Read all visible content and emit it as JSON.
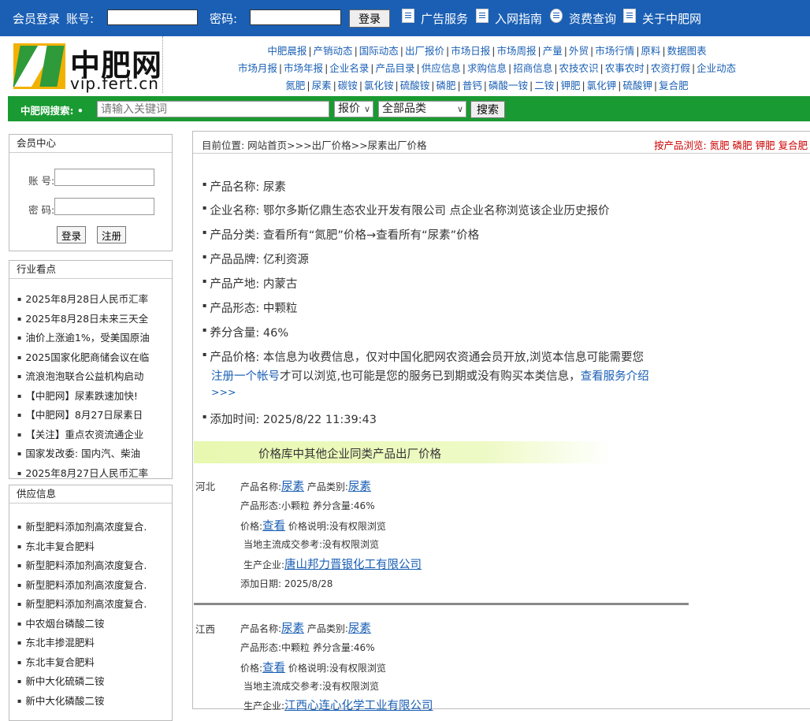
{
  "topbar": {
    "member_login": "会员登录",
    "account_label": "账号:",
    "password_label": "密码:",
    "login_button": "登录",
    "links": [
      "广告服务",
      "入网指南",
      "资费查询",
      "关于中肥网"
    ]
  },
  "logo": {
    "name": "中肥网",
    "url": "vip.fert.cn"
  },
  "nav": {
    "row1": [
      "中肥晨报",
      "产销动态",
      "国际动态",
      "出厂报价",
      "市场日报",
      "市场周报",
      "产量",
      "外贸",
      "市场行情",
      "原料",
      "数据图表"
    ],
    "row2": [
      "市场月报",
      "市场年报",
      "企业名录",
      "产品目录",
      "供应信息",
      "求购信息",
      "招商信息",
      "农技农识",
      "农事农时",
      "农资打假",
      "企业动态"
    ],
    "row3": [
      "氮肥",
      "尿素",
      "碳铵",
      "氯化铵",
      "硫酸铵",
      "磷肥",
      "普钙",
      "磷酸一铵",
      "二铵",
      "钾肥",
      "氯化钾",
      "硫酸钾",
      "复合肥"
    ]
  },
  "search": {
    "label": "中肥网搜索:",
    "placeholder": "请输入关键词",
    "type_select": "报价",
    "category_select": "全部品类",
    "button": "搜索"
  },
  "sidebar": {
    "member": {
      "title": "会员中心",
      "account_label": "账 号:",
      "password_label": "密 码:",
      "login": "登录",
      "register": "注册"
    },
    "industry": {
      "title": "行业看点",
      "items": [
        "2025年8月28日人民币汇率",
        "2025年8月28日未来三天全",
        "油价上涨逾1%，受美国原油",
        "2025国家化肥商储会议在临",
        "流浪泡泡联合公益机构启动",
        "【中肥网】尿素跌速加快!",
        "【中肥网】8月27日尿素日",
        "【关注】重点农资流通企业",
        "国家发改委: 国内汽、柴油",
        "2025年8月27日人民币汇率"
      ]
    },
    "supply": {
      "title": "供应信息",
      "items": [
        "新型肥料添加剂高浓度复合.",
        "东北丰复合肥料",
        "新型肥料添加剂高浓度复合.",
        "新型肥料添加剂高浓度复合.",
        "新型肥料添加剂高浓度复合.",
        "中农烟台磷酸二铵",
        "东北丰掺混肥料",
        "东北丰复合肥料",
        "新中大化硫磷二铵",
        "新中大化磷酸二铵"
      ]
    }
  },
  "breadcrumb": "目前位置: 网站首页>>>出厂价格>>尿素出厂价格",
  "browse": "按产品浏览: 氮肥 磷肥 钾肥 复合肥",
  "detail": {
    "name_label": "产品名称: ",
    "name": "尿素",
    "company_label": "企业名称: ",
    "company": "鄂尔多斯亿鼎生态农业开发有限公司",
    "company_hint": "点企业名称浏览该企业历史报价",
    "category_label": "产品分类: ",
    "category_text": "查看所有“氮肥”价格→查看所有“尿素”价格",
    "brand_label": "产品品牌: ",
    "brand": "亿利资源",
    "origin_label": "产品产地: ",
    "origin": "内蒙古",
    "form_label": "产品形态: ",
    "form": "中颗粒",
    "nutrient_label": "养分含量: ",
    "nutrient": "46%",
    "price_label": "产品价格: ",
    "price_line1": "本信息为收费信息，仅对中国化肥网农资通会员开放,浏览本信息可能需要您",
    "price_register": "注册一个帐号",
    "price_line2": "才可以浏览,也可能是您的服务已到期或没有购买本类信息，",
    "price_service": "查看服务介绍",
    "price_more": ">>>",
    "added_label": "添加时间: ",
    "added": "2025/8/22 11:39:43"
  },
  "others_title": "价格库中其他企业同类产品出厂价格",
  "listings": [
    {
      "province": "河北",
      "name_label": "产品名称:",
      "name": "尿素",
      "cat_label": "产品类别:",
      "cat": "尿素",
      "form": "产品形态:小颗粒",
      "nutrient": "养分含量:46%",
      "price_label": "价格:",
      "price_link": "查看",
      "price_note": "价格说明:没有权限浏览",
      "ref": "当地主流成交参考:没有权限浏览",
      "company_label": "生产企业:",
      "company": "唐山邦力晋银化工有限公司",
      "date": "添加日期: 2025/8/28"
    },
    {
      "province": "江西",
      "name_label": "产品名称:",
      "name": "尿素",
      "cat_label": "产品类别:",
      "cat": "尿素",
      "form": "产品形态:中颗粒",
      "nutrient": "养分含量:46%",
      "price_label": "价格:",
      "price_link": "查看",
      "price_note": "价格说明:没有权限浏览",
      "ref": "当地主流成交参考:没有权限浏览",
      "company_label": "生产企业:",
      "company": "江西心连心化学工业有限公司"
    }
  ]
}
